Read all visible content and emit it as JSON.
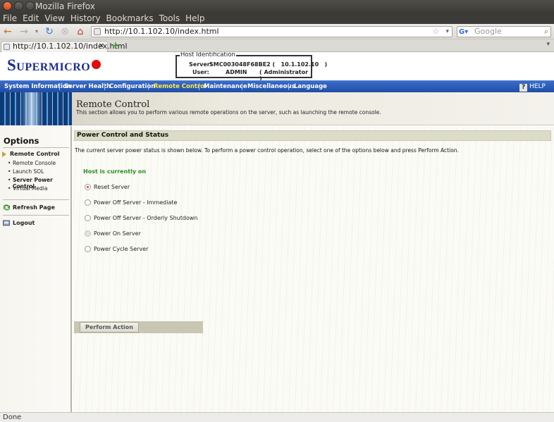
{
  "window": {
    "title": "Mozilla Firefox"
  },
  "menu": [
    "File",
    "Edit",
    "View",
    "History",
    "Bookmarks",
    "Tools",
    "Help"
  ],
  "toolbar": {
    "url": "http://10.1.102.10/index.html",
    "search_placeholder": "Google"
  },
  "tab": {
    "title": "http://10.1.102.10/index.html"
  },
  "header": {
    "logo": "Supermicro",
    "host_legend": "Host Identification",
    "server_label": "Server:",
    "server_value": "SMC003048F68BE2 (   10.1.102.10   )",
    "user_label": "User:",
    "user_value": "ADMIN",
    "user_role": "( Administrator )"
  },
  "nav": {
    "items": [
      "System Information",
      "Server Health",
      "Configuration",
      "Remote Control",
      "Maintenance",
      "Miscellaneous",
      "Language"
    ],
    "active": "Remote Control",
    "help": "HELP"
  },
  "banner": {
    "title": "Remote Control",
    "desc": "This section allows you to perform various remote operations on the server, such as launching the remote console."
  },
  "sidebar": {
    "heading": "Options",
    "group": "Remote Control",
    "items": [
      "Remote Console",
      "Launch SOL",
      "Server Power Control",
      "Virtual Media"
    ],
    "current": "Server Power Control",
    "refresh": "Refresh Page",
    "logout": "Logout"
  },
  "content": {
    "heading": "Power Control and Status",
    "desc": "The current server power status is shown below. To perform a power control operation, select one of the options below and press Perform Action.",
    "status": "Host is currently on",
    "options": [
      {
        "label": "Reset Server",
        "checked": true,
        "disabled": false
      },
      {
        "label": "Power Off Server - Immediate",
        "checked": false,
        "disabled": false
      },
      {
        "label": "Power Off Server - Orderly Shutdown",
        "checked": false,
        "disabled": false
      },
      {
        "label": "Power On Server",
        "checked": false,
        "disabled": true
      },
      {
        "label": "Power Cycle Server",
        "checked": false,
        "disabled": false
      }
    ],
    "action_button": "Perform Action"
  },
  "status_bar": "Done"
}
